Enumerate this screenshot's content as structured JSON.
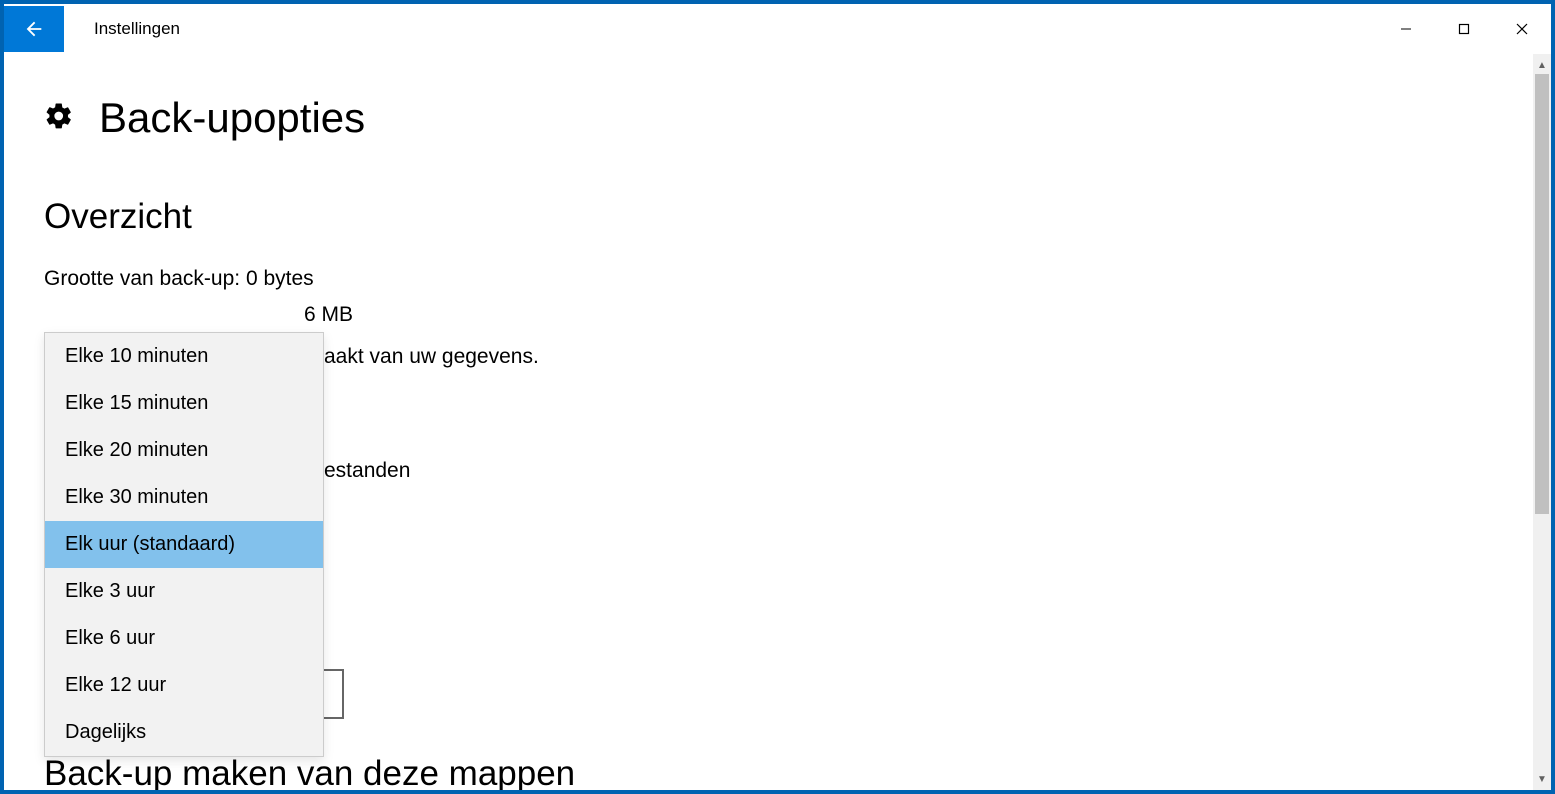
{
  "window": {
    "title": "Instellingen"
  },
  "page": {
    "title": "Back-upopties",
    "overview_heading": "Overzicht",
    "backup_size_line": "Grootte van back-up: 0 bytes",
    "storage_partial": "6 MB",
    "description_tail": "aakt van uw gegevens.",
    "freq_label_tail": "estanden",
    "folders_heading": "Back-up maken van deze mappen"
  },
  "dropdown": {
    "items": [
      {
        "label": "Elke 10 minuten",
        "selected": false
      },
      {
        "label": "Elke 15 minuten",
        "selected": false
      },
      {
        "label": "Elke 20 minuten",
        "selected": false
      },
      {
        "label": "Elke 30 minuten",
        "selected": false
      },
      {
        "label": "Elk uur (standaard)",
        "selected": true
      },
      {
        "label": "Elke 3 uur",
        "selected": false
      },
      {
        "label": "Elke 6 uur",
        "selected": false
      },
      {
        "label": "Elke 12 uur",
        "selected": false
      },
      {
        "label": "Dagelijks",
        "selected": false
      }
    ]
  }
}
